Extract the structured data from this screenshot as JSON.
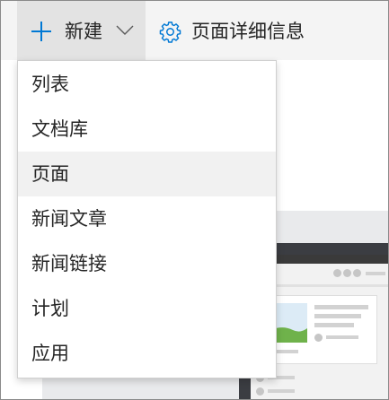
{
  "toolbar": {
    "new_label": "新建",
    "details_label": "页面详细信息",
    "new_icon": "plus-icon",
    "new_menu_icon": "chevron-down-icon",
    "details_icon": "gear-icon"
  },
  "menu": {
    "items": [
      {
        "label": "列表"
      },
      {
        "label": "文档库"
      },
      {
        "label": "页面",
        "hovered": true
      },
      {
        "label": "新闻文章"
      },
      {
        "label": "新闻链接"
      },
      {
        "label": "计划"
      },
      {
        "label": "应用"
      }
    ]
  },
  "colors": {
    "accent": "#0078d4",
    "toolbar_bg": "#f4f4f4",
    "button_pressed_bg": "#e3e3e3",
    "menu_hover_bg": "#f1f1f1",
    "text": "#252525"
  }
}
